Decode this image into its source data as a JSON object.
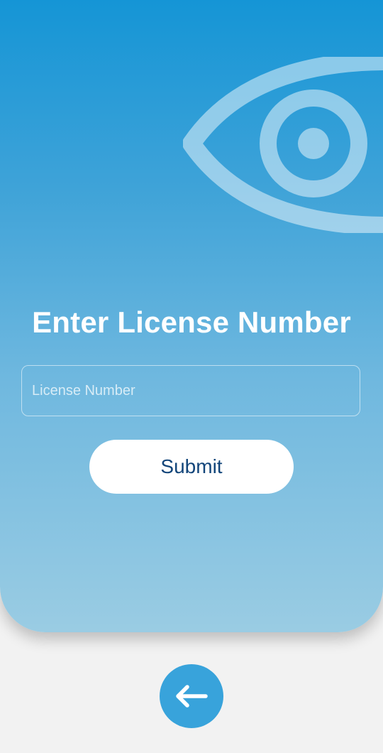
{
  "page": {
    "title": "Enter License Number"
  },
  "license_input": {
    "placeholder": "License Number",
    "value": ""
  },
  "submit_button": {
    "label": "Submit"
  },
  "icons": {
    "hero": "eye-icon",
    "back": "arrow-left-icon"
  },
  "colors": {
    "gradient_top": "#1595d6",
    "gradient_bottom": "#9acce3",
    "submit_text": "#12457a",
    "back_button": "#38a3db",
    "page_background": "#f2f2f2"
  }
}
